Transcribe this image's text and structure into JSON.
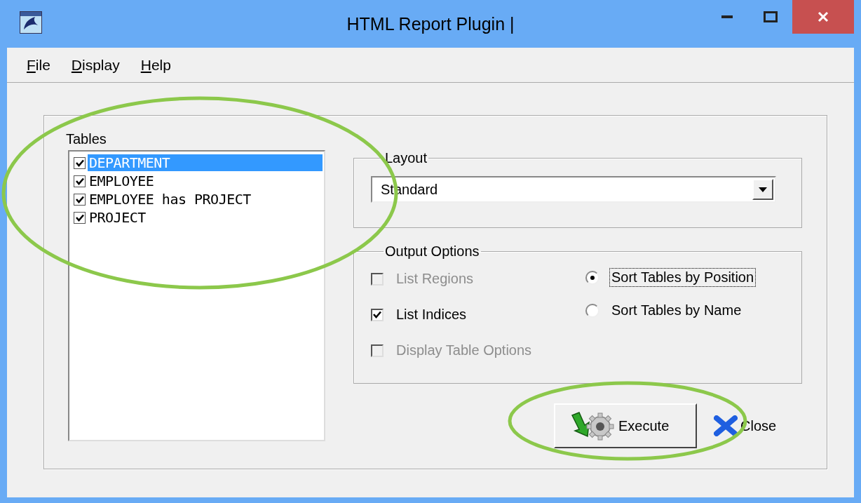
{
  "window": {
    "title": "HTML Report Plugin |"
  },
  "menu": [
    {
      "label": "File"
    },
    {
      "label": "Display"
    },
    {
      "label": "Help"
    }
  ],
  "tables": {
    "label": "Tables",
    "items": [
      {
        "name": "DEPARTMENT",
        "checked": true,
        "selected": true
      },
      {
        "name": "EMPLOYEE",
        "checked": true,
        "selected": false
      },
      {
        "name": "EMPLOYEE has PROJECT",
        "checked": true,
        "selected": false
      },
      {
        "name": "PROJECT",
        "checked": true,
        "selected": false
      }
    ]
  },
  "layout": {
    "label": "Layout",
    "value": "Standard"
  },
  "output_options": {
    "label": "Output Options",
    "checkboxes": [
      {
        "label": "List Regions",
        "checked": false,
        "disabled": true
      },
      {
        "label": "List Indices",
        "checked": true,
        "disabled": false
      },
      {
        "label": "Display Table Options",
        "checked": false,
        "disabled": true
      }
    ],
    "radios": [
      {
        "label": "Sort Tables by Position",
        "selected": true,
        "focused": true
      },
      {
        "label": "Sort Tables by Name",
        "selected": false,
        "focused": false
      }
    ]
  },
  "buttons": [
    {
      "kind": "execute",
      "label": "Execute"
    },
    {
      "kind": "close",
      "label": "Close"
    }
  ]
}
